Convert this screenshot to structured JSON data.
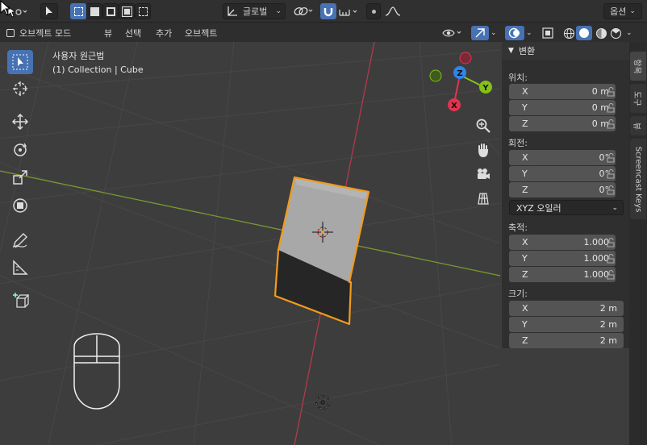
{
  "topbar": {
    "view_layer_label": "글로벌",
    "options_label": "옵션"
  },
  "header": {
    "mode_label": "오브젝트 모드",
    "menu": [
      "뷰",
      "선택",
      "추가",
      "오브젝트"
    ]
  },
  "viewport": {
    "view_name": "사용자 원근법",
    "collection_info": "(1) Collection | Cube",
    "gizmo_axes": [
      "X",
      "Y",
      "Z"
    ]
  },
  "npanel": {
    "title": "변환",
    "location_label": "위치:",
    "location": [
      {
        "axis": "X",
        "value": "0 m"
      },
      {
        "axis": "Y",
        "value": "0 m"
      },
      {
        "axis": "Z",
        "value": "0 m"
      }
    ],
    "rotation_label": "회전:",
    "rotation": [
      {
        "axis": "X",
        "value": "0°"
      },
      {
        "axis": "Y",
        "value": "0°"
      },
      {
        "axis": "Z",
        "value": "0°"
      }
    ],
    "rotation_mode": "XYZ 오일러",
    "scale_label": "축적:",
    "scale": [
      {
        "axis": "X",
        "value": "1.000"
      },
      {
        "axis": "Y",
        "value": "1.000"
      },
      {
        "axis": "Z",
        "value": "1.000"
      }
    ],
    "dimensions_label": "크기:",
    "dimensions": [
      {
        "axis": "X",
        "value": "2 m"
      },
      {
        "axis": "Y",
        "value": "2 m"
      },
      {
        "axis": "Z",
        "value": "2 m"
      }
    ]
  },
  "sidetabs": [
    "항목",
    "도구",
    "뷰",
    "Screencast Keys"
  ],
  "colors": {
    "accent": "#4772b3",
    "x_axis": "#e2344e",
    "y_axis": "#84c217",
    "z_axis": "#2f85e8",
    "selection": "#f29b1d"
  }
}
